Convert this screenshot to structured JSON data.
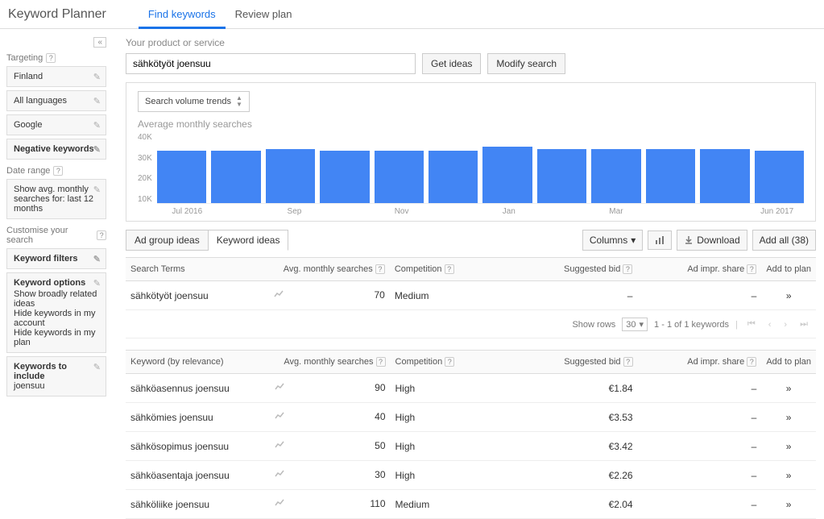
{
  "header": {
    "title": "Keyword Planner",
    "tabs": [
      {
        "label": "Find keywords",
        "active": true
      },
      {
        "label": "Review plan",
        "active": false
      }
    ]
  },
  "sidebar": {
    "targeting_label": "Targeting",
    "targeting": [
      "Finland",
      "All languages",
      "Google",
      "Negative keywords"
    ],
    "date_range_label": "Date range",
    "date_range_text": "Show avg. monthly searches for: last 12 months",
    "customise_label": "Customise your search",
    "filters_label": "Keyword filters",
    "options_label": "Keyword options",
    "options_lines": [
      "Show broadly related ideas",
      "Hide keywords in my account",
      "Hide keywords in my plan"
    ],
    "include_label": "Keywords to include",
    "include_value": "joensuu"
  },
  "main": {
    "prompt": "Your product or service",
    "search_value": "sähkötyöt joensuu",
    "get_ideas": "Get ideas",
    "modify_search": "Modify search",
    "trends_label": "Search volume trends",
    "chart_title": "Average monthly searches"
  },
  "chart_data": {
    "type": "bar",
    "ylim": [
      0,
      40000
    ],
    "yticks": [
      "40K",
      "30K",
      "20K",
      "10K"
    ],
    "categories": [
      "Jul 2016",
      "Aug",
      "Sep",
      "Oct",
      "Nov",
      "Dec",
      "Jan",
      "Feb",
      "Mar",
      "Apr",
      "May",
      "Jun 2017"
    ],
    "values": [
      30000,
      30000,
      31000,
      30000,
      30000,
      30000,
      32000,
      31000,
      31000,
      31000,
      31000,
      30000
    ],
    "xlabels": [
      "Jul 2016",
      "",
      "Sep",
      "",
      "Nov",
      "",
      "Jan",
      "",
      "Mar",
      "",
      "",
      "Jun 2017"
    ]
  },
  "toolbar": {
    "ad_group_tab": "Ad group ideas",
    "keyword_tab": "Keyword ideas",
    "columns": "Columns",
    "download": "Download",
    "add_all": "Add all (38)"
  },
  "columns": {
    "search_terms": "Search Terms",
    "avg": "Avg. monthly searches",
    "competition": "Competition",
    "bid": "Suggested bid",
    "impr": "Ad impr. share",
    "add": "Add to plan",
    "by_relevance": "Keyword (by relevance)"
  },
  "search_terms_rows": [
    {
      "term": "sähkötyöt joensuu",
      "avg": "70",
      "competition": "Medium",
      "bid": "–",
      "impr": "–"
    }
  ],
  "pager": {
    "show_rows": "Show rows",
    "rows": "30",
    "range": "1 - 1 of 1 keywords"
  },
  "keyword_rows": [
    {
      "term": "sähköasennus joensuu",
      "avg": "90",
      "competition": "High",
      "bid": "€1.84",
      "impr": "–"
    },
    {
      "term": "sähkömies joensuu",
      "avg": "40",
      "competition": "High",
      "bid": "€3.53",
      "impr": "–"
    },
    {
      "term": "sähkösopimus joensuu",
      "avg": "50",
      "competition": "High",
      "bid": "€3.42",
      "impr": "–"
    },
    {
      "term": "sähköasentaja joensuu",
      "avg": "30",
      "competition": "High",
      "bid": "€2.26",
      "impr": "–"
    },
    {
      "term": "sähköliike joensuu",
      "avg": "110",
      "competition": "Medium",
      "bid": "€2.04",
      "impr": "–"
    }
  ]
}
